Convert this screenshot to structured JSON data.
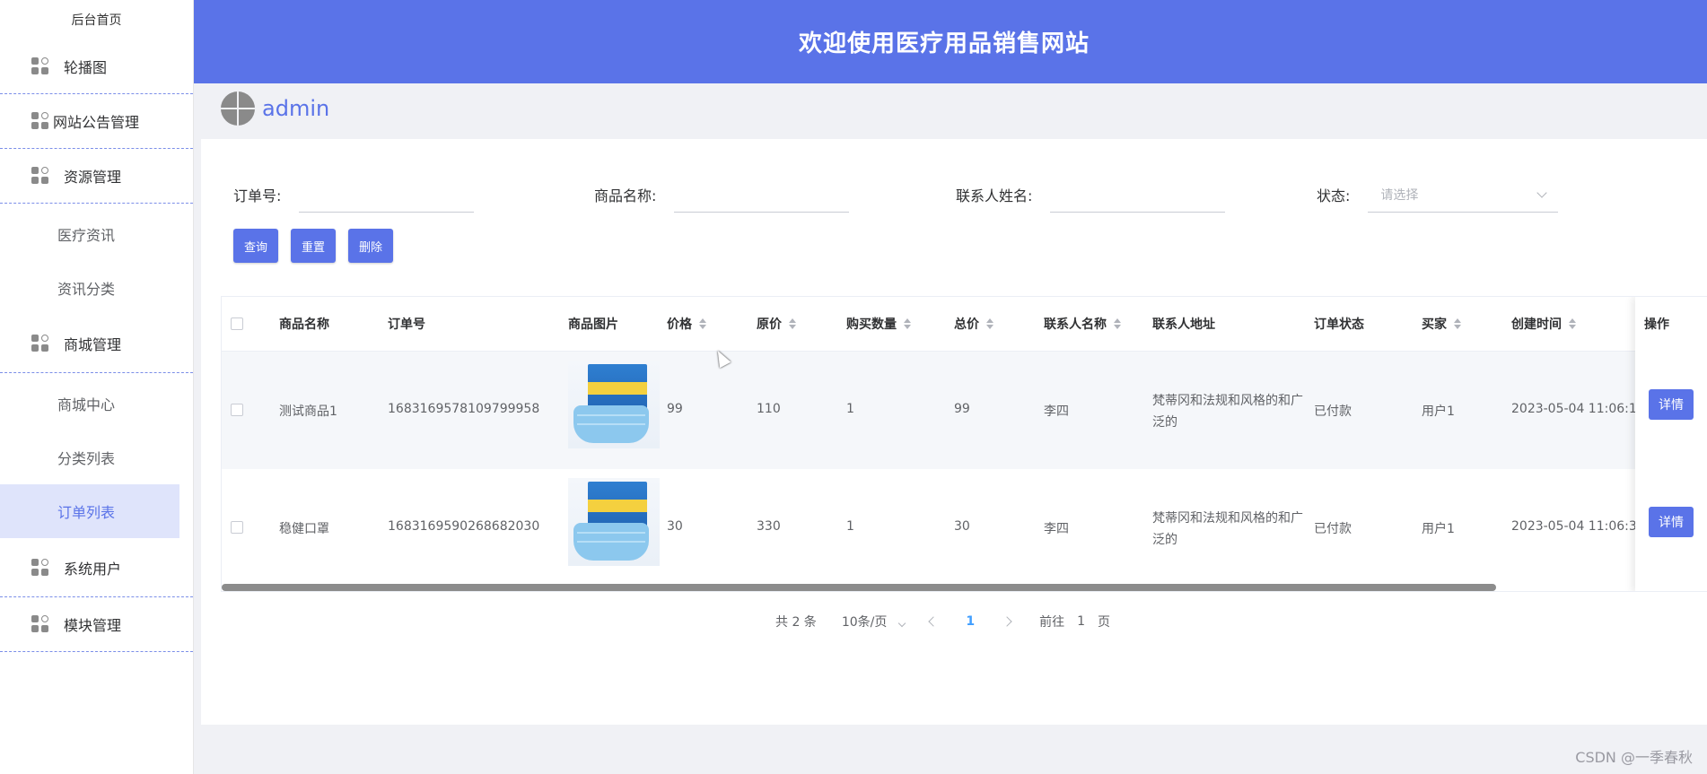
{
  "sidebar": {
    "home": "后台首页",
    "groups": {
      "carousel": "轮播图",
      "notice": "网站公告管理",
      "resource": "资源管理",
      "mall": "商城管理",
      "users": "系统用户",
      "modules": "模块管理"
    },
    "resource_items": [
      "医疗资讯",
      "资讯分类"
    ],
    "mall_items": [
      "商城中心",
      "分类列表",
      "订单列表"
    ]
  },
  "header": {
    "title": "欢迎使用医疗用品销售网站"
  },
  "user": {
    "name": "admin"
  },
  "filters": {
    "order_no": "订单号:",
    "product_name": "商品名称:",
    "contact_name": "联系人姓名:",
    "status": "状态:",
    "status_placeholder": "请选择"
  },
  "buttons": {
    "query": "查询",
    "reset": "重置",
    "delete": "删除"
  },
  "table": {
    "headers": [
      "商品名称",
      "订单号",
      "商品图片",
      "价格",
      "原价",
      "购买数量",
      "总价",
      "联系人名称",
      "联系人地址",
      "订单状态",
      "买家",
      "创建时间",
      "操作"
    ],
    "rows": [
      {
        "name": "测试商品1",
        "order_no": "1683169578109799958",
        "price": "99",
        "original": "110",
        "qty": "1",
        "total": "99",
        "contact": "李四",
        "address": "梵蒂冈和法规和风格的和广泛的",
        "status": "已付款",
        "buyer": "用户1",
        "created": "2023-05-04 11:06:1",
        "action": "详情"
      },
      {
        "name": "稳健口罩",
        "order_no": "1683169590268682030",
        "price": "30",
        "original": "330",
        "qty": "1",
        "total": "30",
        "contact": "李四",
        "address": "梵蒂冈和法规和风格的和广泛的",
        "status": "已付款",
        "buyer": "用户1",
        "created": "2023-05-04 11:06:3",
        "action": "详情"
      }
    ]
  },
  "pagination": {
    "total": "共 2 条",
    "page_size": "10条/页",
    "current": "1",
    "goto_prefix": "前往",
    "goto_value": "1",
    "goto_suffix": "页"
  },
  "watermark": "CSDN @一季春秋",
  "colors": {
    "primary": "#5a73e8",
    "active_bg": "#dfe4fb"
  },
  "icons": {
    "menu": "grid-icon",
    "sort": "sort-caret-icon"
  }
}
